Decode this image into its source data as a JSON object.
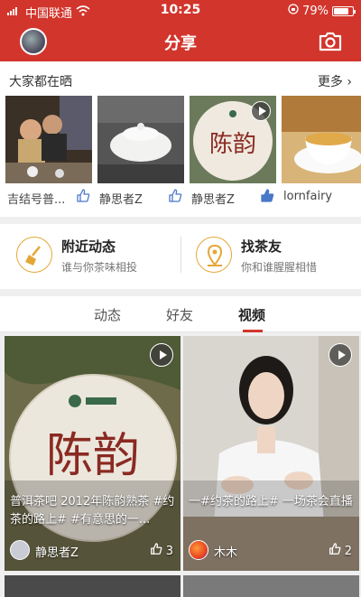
{
  "status_bar": {
    "carrier": "中国联通",
    "time": "10:25",
    "battery": "79%",
    "battery_level": 0.79
  },
  "nav": {
    "title": "分享"
  },
  "popular": {
    "heading": "大家都在晒",
    "more": "更多",
    "users": [
      {
        "name": "吉结号普..."
      },
      {
        "name": "静思者Z"
      },
      {
        "name": "静思者Z"
      },
      {
        "name": "lornfairy"
      }
    ]
  },
  "features": [
    {
      "title": "附近动态",
      "subtitle": "谁与你茶味相投",
      "icon": "broom-icon"
    },
    {
      "title": "找茶友",
      "subtitle": "你和谁腥腥相惜",
      "icon": "location-pin-icon"
    }
  ],
  "tabs": [
    {
      "label": "动态"
    },
    {
      "label": "好友"
    },
    {
      "label": "视频"
    }
  ],
  "active_tab": "视频",
  "videos": [
    {
      "caption": "普洱茶吧 2012年陈韵熟茶 #约茶的路上# #有意思的一...",
      "author": "静思者Z",
      "likes": "3"
    },
    {
      "caption": "一#约茶的路上# 一场茶会直播",
      "author": "木木",
      "likes": "2"
    }
  ],
  "colors": {
    "brand_red": "#d2352c",
    "accent_gold": "#e4a737",
    "like_blue": "#4a78c8"
  }
}
